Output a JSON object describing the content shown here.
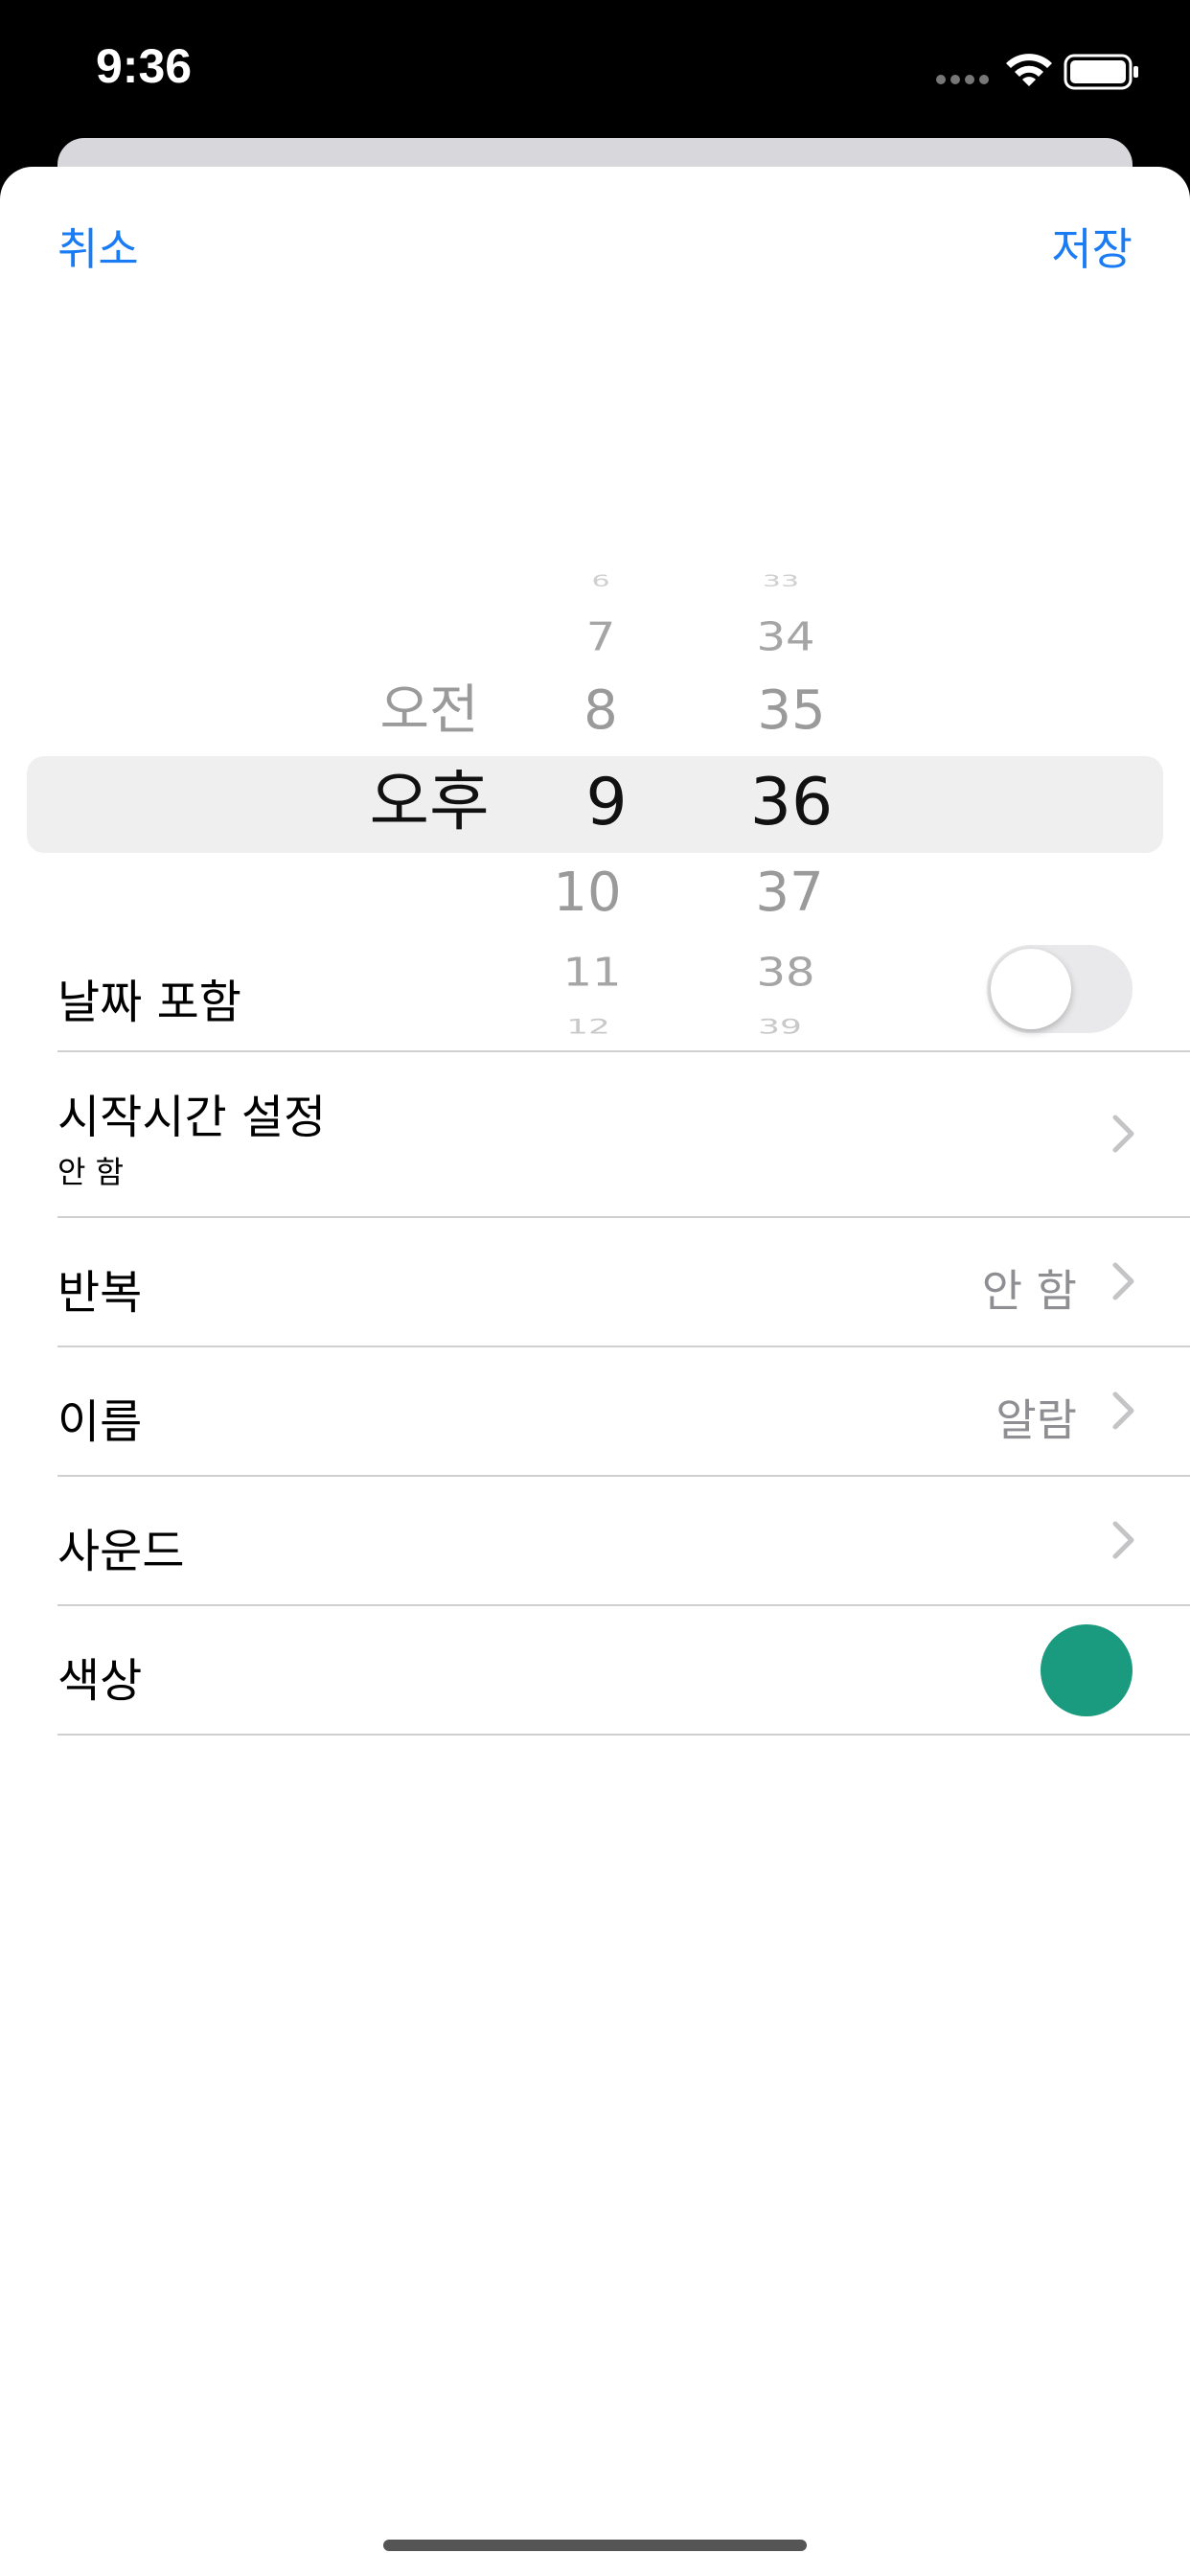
{
  "status_bar": {
    "time": "9:36"
  },
  "nav": {
    "cancel_label": "취소",
    "save_label": "저장"
  },
  "picker": {
    "ampm": {
      "items": [
        "오전",
        "오후"
      ],
      "selected": "오후"
    },
    "hours": {
      "items": [
        "6",
        "7",
        "8",
        "9",
        "10",
        "11",
        "12"
      ],
      "selected": "9"
    },
    "minutes": {
      "items": [
        "33",
        "34",
        "35",
        "36",
        "37",
        "38",
        "39"
      ],
      "selected": "36"
    }
  },
  "settings": {
    "include_date": {
      "label": "날짜 포함",
      "toggle_on": false
    },
    "start_time": {
      "label": "시작시간 설정",
      "subtitle": "안 함"
    },
    "repeat": {
      "label": "반복",
      "value": "안 함"
    },
    "name": {
      "label": "이름",
      "value": "알람"
    },
    "sound": {
      "label": "사운드"
    },
    "color": {
      "label": "색상",
      "value_hex": "#1a9a7e"
    }
  },
  "colors": {
    "accent": "#1a7cf5",
    "secondary_text": "#8e8e93",
    "selected_color": "#1a9a7e"
  }
}
